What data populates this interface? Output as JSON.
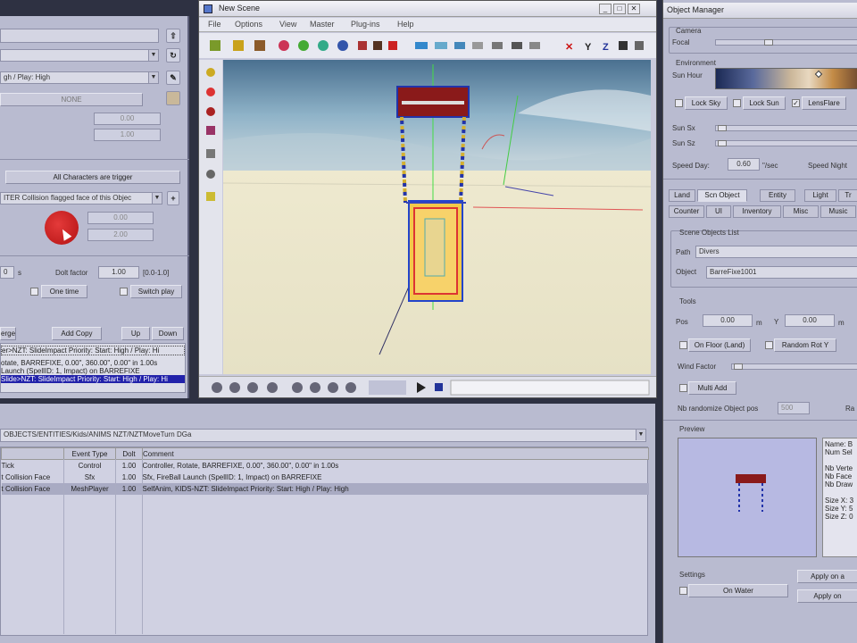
{
  "left": {
    "dropdown1": "",
    "dropdown2": "gh / Play: High",
    "none_btn": "NONE",
    "val1": "0.00",
    "val2": "1.00",
    "all_chars_btn": "All Characters are trigger",
    "collision_dd": "ITER Collision flagged face of this Objec",
    "val3": "0.00",
    "val4": "2.00",
    "num_a": "0",
    "unit_s": "s",
    "dolt_label": "Dolt factor",
    "dolt_value": "1.00",
    "dolt_range": "[0.0-1.0]",
    "one_time": "One time",
    "switch_play": "Switch play",
    "btn_merge": "erge",
    "btn_add_copy": "Add Copy",
    "btn_up": "Up",
    "btn_down": "Down",
    "list": [
      "er>NZT: SlideImpact Priority: Start: High / Play: Hi",
      "otate, BARREFIXE, 0.00\", 360.00\", 0.00\" in 1.00s",
      "Launch (SpellID: 1, Impact) on BARREFIXE",
      "Slide>NZT: SlideImpact Priority: Start: High / Play: Hi"
    ]
  },
  "scene": {
    "title": "New Scene",
    "menu": [
      "File",
      "Options",
      "View",
      "Master",
      "Plug-ins",
      "Help"
    ]
  },
  "bottom": {
    "path": "OBJECTS/ENTITIES/Kids/ANIMS NZT/NZTMoveTurn DGa",
    "columns": [
      "",
      "Event Type",
      "Dolt",
      "Comment"
    ],
    "rows": [
      [
        "Tick",
        "Control",
        "1.00",
        "Controller, Rotate, BARREFIXE, 0.00\", 360.00\", 0.00\" in 1.00s"
      ],
      [
        "t Collision Face",
        "Sfx",
        "1.00",
        "Sfx, FireBall Launch (SpellID: 1, Impact) on BARREFIXE"
      ],
      [
        "t Collision Face",
        "MeshPlayer",
        "1.00",
        "SelfAnim, KIDS-NZT: SlideImpact Priority: Start: High / Play: High"
      ]
    ]
  },
  "om": {
    "title": "Object Manager",
    "camera_label": "Camera",
    "focal_label": "Focal",
    "env_label": "Environment",
    "sun_hour_label": "Sun Hour",
    "lock_sky": "Lock Sky",
    "lock_sun": "Lock Sun",
    "lensflare": "LensFlare",
    "sun_sx": "Sun Sx",
    "sun_sz": "Sun Sz",
    "speed_day_label": "Speed Day:",
    "speed_day_value": "0.60",
    "speed_unit": "\"/sec",
    "speed_night_label": "Speed Night",
    "tabs_row1": [
      "Land",
      "Scn Object",
      "Entity",
      "Light",
      "Tr"
    ],
    "tabs_row2": [
      "Counter",
      "UI",
      "Inventory",
      "Misc",
      "Music"
    ],
    "scene_objects_label": "Scene Objects List",
    "path_label": "Path",
    "path_value": "Divers",
    "object_label": "Object",
    "object_value": "BarreFixe1001",
    "tools_label": "Tools",
    "pos_label": "Pos",
    "pos_x": "0.00",
    "unit_m": "m",
    "y_label": "Y",
    "pos_y": "0.00",
    "on_floor": "On Floor (Land)",
    "random_rot": "Random Rot Y",
    "wind_factor": "Wind Factor",
    "multi_add": "Multi Add",
    "nb_randomize": "Nb randomize Object pos",
    "nb_randomize_value": "500",
    "ra_label": "Ra",
    "preview_label": "Preview",
    "info_lines": [
      "Name: B",
      "Num Sel",
      "",
      "Nb Verte",
      "Nb Face",
      "Nb Draw",
      "",
      "Size X: 3",
      "Size Y: 5",
      "Size Z: 0"
    ],
    "settings_label": "Settings",
    "on_water": "On Water",
    "apply_on_1": "Apply on a",
    "apply_on_2": "Apply on"
  },
  "colors": {
    "panel": "#b9bbd0",
    "selection": "#2222aa",
    "record_red": "#cc1a1a"
  }
}
